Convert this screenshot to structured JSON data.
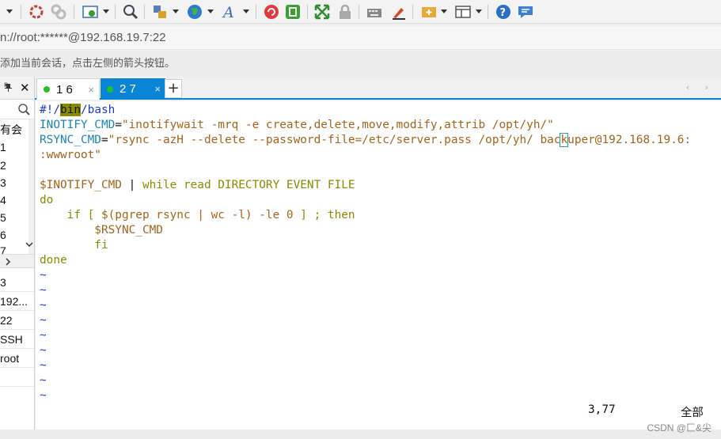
{
  "address": "n://root:******@192.168.19.7:22",
  "hint": "添加当前会话，点击左侧的箭头按钮。",
  "left_panel": {
    "items_top": [
      "有会",
      "1",
      "2",
      "3",
      "4",
      "5",
      "6",
      "7"
    ],
    "items_bottom": [
      "3",
      "192...",
      "22",
      "SSH",
      "root"
    ]
  },
  "tabs": [
    {
      "label": "1 6",
      "close": "×"
    },
    {
      "label": "2 7",
      "close": "×"
    }
  ],
  "tab_add": "+",
  "tab_nav": "‹ ›",
  "terminal": {
    "shebang_prefix": "#!/",
    "shebang_bin": "bin",
    "shebang_rest": "/bash",
    "l2_var": "INOTIFY_CMD",
    "l2_eq": "=",
    "l2_str": "\"inotifywait -mrq -e create,delete,move,modify,attrib /opt/yh/\"",
    "l3_var": "RSYNC_CMD",
    "l3_eq": "=",
    "l3_str_a": "\"rsync -azH --delete --password-file=/etc/server.pass /opt/yh/ bac",
    "l3_cursor": "k",
    "l3_str_b": "uper@192.168.19.6:",
    "l4": ":wwwroot\"",
    "l6_var": "$INOTIFY_CMD",
    "l6_pipe": " | ",
    "l6_rest": "while read DIRECTORY EVENT FILE",
    "l7": "do",
    "l8_if": "    if [ ",
    "l8_sub": "$(pgrep rsync | wc -l) -le 0",
    "l8_close": " ] ; ",
    "l8_then": "then",
    "l9": "        $RSYNC_CMD",
    "l10": "        fi",
    "l11": "done",
    "tilde": "~",
    "status_pos": "3,77",
    "status_all": "全部"
  },
  "watermark": "CSDN @匚&尖",
  "colors": {
    "accent": "#0a84d6",
    "tab_dot": "#22c02a"
  }
}
